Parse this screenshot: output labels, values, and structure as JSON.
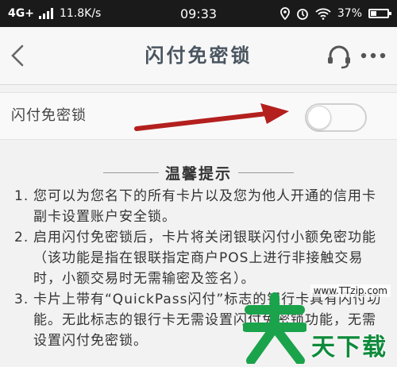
{
  "status_bar": {
    "network": "4G+",
    "speed": "11.8K/s",
    "time": "09:33",
    "battery": "37%",
    "battery_level": 0.37
  },
  "nav": {
    "title": "闪付免密锁"
  },
  "setting": {
    "label": "闪付免密锁",
    "toggle_on": false
  },
  "tips": {
    "title": "温馨提示",
    "items": [
      {
        "num": "1.",
        "text": "您可以为您名下的所有卡片以及您为他人开通的信用卡副卡设置账户安全锁。"
      },
      {
        "num": "2.",
        "text": "启用闪付免密锁后，卡片将关闭银联闪付小额免密功能（该功能是指在银联指定商户POS上进行非接触交易时，小额交易时无需输密及签名）。"
      },
      {
        "num": "3.",
        "text": "卡片上带有“QuickPass闪付”标志的银行卡具有闪付功能。无此标志的银行卡无需设置闪付免密锁功能，无需设置闪付免密锁。"
      }
    ]
  },
  "watermark": {
    "url": "www.TTzip.com",
    "text": "天下载"
  },
  "colors": {
    "status_bg": "#1a1a1a",
    "arrow": "#b3201e",
    "watermark_green": "#0e8a3b"
  }
}
